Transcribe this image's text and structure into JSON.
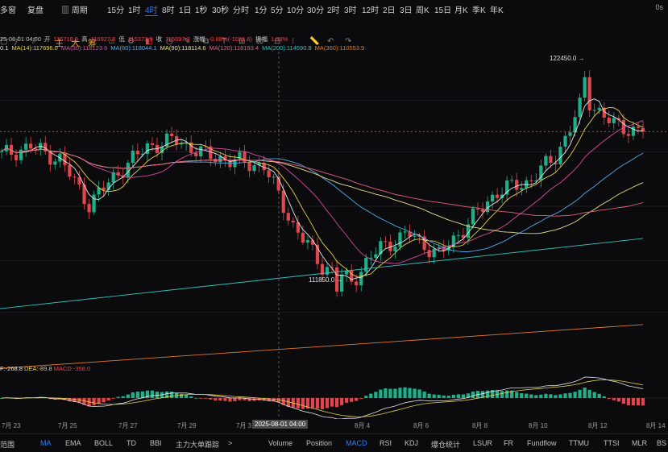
{
  "toolbar": {
    "items": [
      "多窗",
      "复盘",
      "周期",
      "15分",
      "1时",
      "4时",
      "8时",
      "1日",
      "1秒",
      "30秒",
      "分时",
      "1分",
      "5分",
      "10分",
      "30分",
      "2时",
      "3时",
      "12时",
      "2日",
      "3日",
      "周K",
      "15日",
      "月K",
      "季K",
      "年K"
    ],
    "active_index": 5,
    "version": "0s"
  },
  "row2": {
    "zhu": "主",
    "da": "大",
    "chou": "筹"
  },
  "ohlc": {
    "date": "25-08-01 04:00",
    "open_label": "开",
    "open": "116718.9",
    "high_label": "高",
    "high": "116927.8",
    "low_label": "低",
    "low": "115373.9",
    "close_label": "收",
    "close": "115697.3",
    "change_label": "涨幅",
    "change": "-0.88%(-1021.6)",
    "amp_label": "振幅",
    "amp": "1.33%"
  },
  "ma": {
    "ma7": "0.1",
    "ma14": "MA(14):117696.0",
    "ma30": "MA(30):118123.6",
    "ma60": "MA(60):118044.1",
    "ma90": "MA(90):118114.6",
    "ma120": "MA(120):118193.4",
    "ma200": "MA(200):114590.8",
    "ma360": "MA(360):110553.9"
  },
  "macd_info": {
    "dif": "F:-268.8",
    "dea": "DEA:-89.8",
    "macd": "MACD:-358.0"
  },
  "price_labels": {
    "high": "122450.0",
    "low": "111850.0"
  },
  "xaxis": {
    "labels": [
      "7月 23",
      "7月 25",
      "7月 27",
      "7月 29",
      "7月 3",
      "8月 4",
      "8月 6",
      "8月 8",
      "8月 10",
      "8月 12",
      "8月 14"
    ],
    "tooltip": "2025-08-01 04:00"
  },
  "bottom_tabs": {
    "left": [
      "范围",
      "MA",
      "EMA",
      "BOLL",
      "TD",
      "BBI",
      "主力大单跟踪",
      ">"
    ],
    "right": [
      "Volume",
      "Position",
      "MACD",
      "RSI",
      "KDJ",
      "爆仓统计",
      "LSUR",
      "FR",
      "Fundflow",
      "TTMU",
      "TTSI",
      "MLR",
      "BS"
    ],
    "active_left": "MA",
    "active_right": "MACD"
  },
  "colors": {
    "up": "#1fb08a",
    "down": "#e0474c",
    "accent": "#2f7cf6",
    "ma14": "#e6d14a",
    "ma30": "#d94aa1",
    "ma60": "#56a9e6",
    "ma90": "#e6e08a",
    "ma120": "#e0607e",
    "ma200": "#2fc2c0",
    "ma360": "#e07a2a"
  },
  "chart_data": {
    "type": "candlestick",
    "interval": "4时",
    "x": [
      "7/22",
      "7/23",
      "7/24",
      "7/25",
      "7/26",
      "7/27",
      "7/28",
      "7/29",
      "7/30",
      "7/31",
      "8/1",
      "8/2",
      "8/3",
      "8/4",
      "8/5",
      "8/6",
      "8/7",
      "8/8",
      "8/9",
      "8/10",
      "8/11",
      "8/12",
      "8/13"
    ],
    "close": [
      118500,
      118900,
      118300,
      116200,
      117700,
      118900,
      119200,
      118500,
      118200,
      118000,
      115200,
      113300,
      112600,
      114200,
      114800,
      113800,
      115300,
      116800,
      117200,
      118400,
      121200,
      119900,
      119600
    ],
    "ylim": [
      109000,
      123200
    ],
    "marked_high": 122450.0,
    "marked_low": 111850.0,
    "ma200_end": 114590.8,
    "ma360_end": 110553.9
  }
}
